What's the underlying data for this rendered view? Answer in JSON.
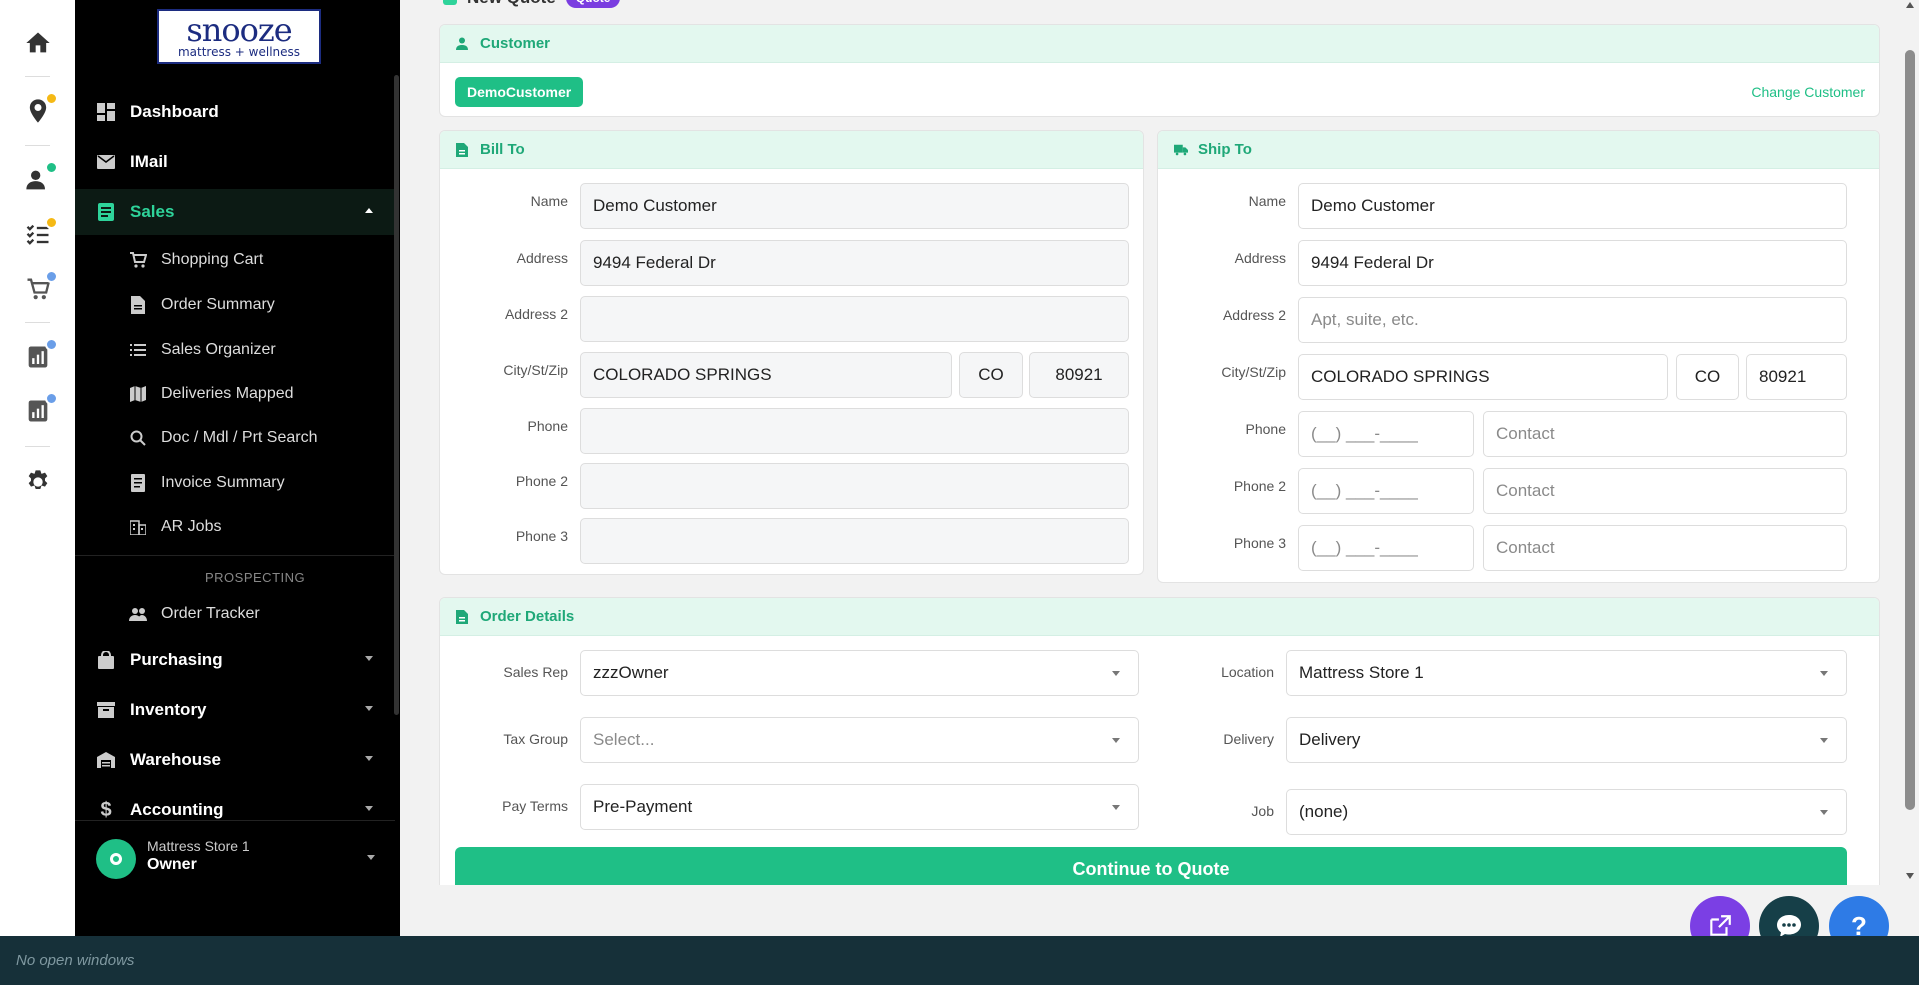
{
  "colors": {
    "accent": "#1fbf86",
    "sidebar_bg": "#000000",
    "badge_purple": "#7a3de0",
    "taskbar": "#163039"
  },
  "logo": {
    "main": "snooze",
    "sub": "mattress + wellness"
  },
  "rail": [
    {
      "icon": "home-icon"
    },
    {
      "icon": "location-pin-icon"
    },
    {
      "icon": "add-person-icon"
    },
    {
      "icon": "checklist-icon"
    },
    {
      "icon": "cart-icon"
    },
    {
      "icon": "report-icon"
    },
    {
      "icon": "report-icon"
    },
    {
      "icon": "gear-icon"
    }
  ],
  "sidebar": {
    "dashboard": "Dashboard",
    "imail": "IMail",
    "sales": "Sales",
    "sales_items": [
      "Shopping Cart",
      "Order Summary",
      "Sales Organizer",
      "Deliveries Mapped",
      "Doc / Mdl / Prt Search",
      "Invoice Summary",
      "AR Jobs"
    ],
    "prospecting_heading": "PROSPECTING",
    "order_tracker": "Order Tracker",
    "purchasing": "Purchasing",
    "inventory": "Inventory",
    "warehouse": "Warehouse",
    "accounting": "Accounting",
    "store": {
      "name": "Mattress Store 1",
      "role": "Owner"
    }
  },
  "page": {
    "title": "New Quote",
    "badge": "Quote"
  },
  "customer": {
    "header": "Customer",
    "chip": "DemoCustomer",
    "change_link": "Change Customer"
  },
  "bill_to": {
    "header": "Bill To",
    "labels": {
      "name": "Name",
      "address": "Address",
      "address2": "Address 2",
      "city": "City/St/Zip",
      "phone": "Phone",
      "phone2": "Phone 2",
      "phone3": "Phone 3"
    },
    "name": "Demo Customer",
    "address": "9494 Federal Dr",
    "address2": "",
    "city": "COLORADO SPRINGS",
    "state": "CO",
    "zip": "80921",
    "phone": "",
    "phone2": "",
    "phone3": ""
  },
  "ship_to": {
    "header": "Ship To",
    "labels": {
      "name": "Name",
      "address": "Address",
      "address2": "Address 2",
      "city": "City/St/Zip",
      "phone": "Phone",
      "phone2": "Phone 2",
      "phone3": "Phone 3"
    },
    "name": "Demo Customer",
    "address": "9494 Federal Dr",
    "address2_placeholder": "Apt, suite, etc.",
    "city": "COLORADO SPRINGS",
    "state": "CO",
    "zip": "80921",
    "phone_placeholder": "(__) ___-____",
    "contact_placeholder": "Contact"
  },
  "order_details": {
    "header": "Order Details",
    "labels": {
      "sales_rep": "Sales Rep",
      "tax_group": "Tax Group",
      "pay_terms": "Pay Terms",
      "location": "Location",
      "delivery": "Delivery",
      "job": "Job"
    },
    "sales_rep": "zzzOwner",
    "tax_group_placeholder": "Select...",
    "pay_terms": "Pre-Payment",
    "location": "Mattress Store 1",
    "delivery": "Delivery",
    "job": "(none)"
  },
  "continue_button": "Continue to Quote",
  "fabs": [
    "external-link-icon",
    "chat-icon",
    "help-icon"
  ],
  "help_label": "?",
  "taskbar": {
    "text": "No open windows"
  }
}
